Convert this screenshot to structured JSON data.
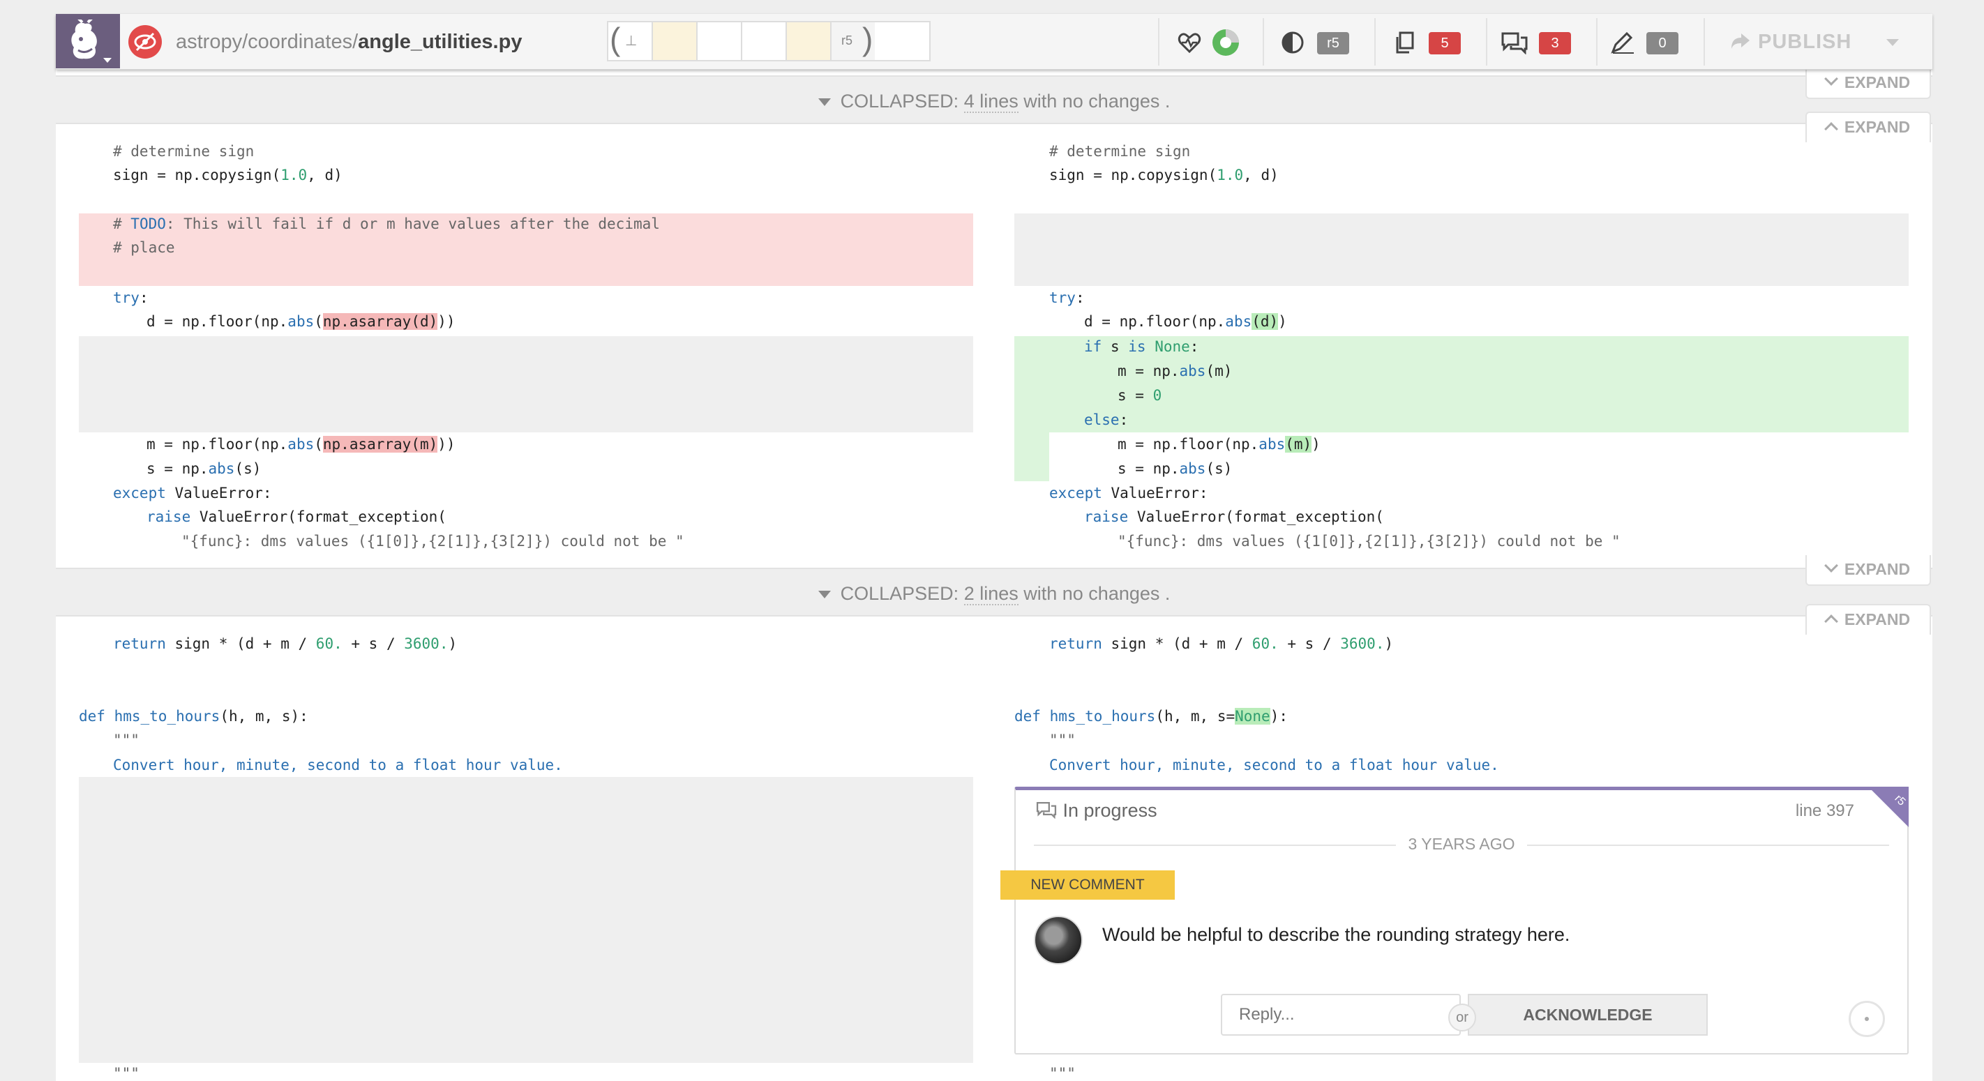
{
  "toolbar": {
    "path_prefix": "astropy/coordinates/",
    "file_name": "angle_utilities.py",
    "rev_base": "⊥",
    "rev_label": "r5",
    "reviewer_badge": "r5",
    "files_count": "5",
    "discussions_count": "3",
    "drafts_count": "0",
    "publish_label": "PUBLISH"
  },
  "collapsed": [
    {
      "label": "COLLAPSED:",
      "count": "4 lines",
      "suffix": " with no changes ."
    },
    {
      "label": "COLLAPSED:",
      "count": "2 lines",
      "suffix": " with no changes ."
    }
  ],
  "expand_label": "EXPAND",
  "code": {
    "comment_determine": "# determine sign",
    "sign_prefix": "sign = np.copysign(",
    "sign_num": "1.0",
    "sign_suffix": ", d)",
    "todo_hash": "# ",
    "todo_kw": "TODO",
    "todo_rest": ": This will fail if d or m have values after the decimal",
    "todo_place": "# place",
    "try": "try",
    "colon": ":",
    "d_line_a": "d = np.floor(np.",
    "abs": "abs",
    "paren": "(",
    "asarray_d": "np.asarray(d)",
    "d_close": "))",
    "d_new_arg": "(d)",
    "m_line_a": "m = np.floor(np.",
    "asarray_m": "np.asarray(m)",
    "s_line_a": "s = np.",
    "s_arg": "(s)",
    "except": "except",
    "except_rest": " ValueError:",
    "raise": "raise",
    "raise_rest": " ValueError(format_exception(",
    "err_str": "\"{func}: dms values ({1[0]},{2[1]},{3[2]}) could not be \"",
    "if": "if",
    "is": "is",
    "none": "None",
    "m_abs_a": "m = np.",
    "m_arg": "(m)",
    "s_zero_a": "s = ",
    "zero": "0",
    "else": "else",
    "m_new_close": "))",
    "return": "return",
    "return_rest_a": " sign * (d + m / ",
    "sixty": "60.",
    "return_rest_b": " + s / ",
    "thirty6": "3600.",
    "return_close": ")",
    "def": "def",
    "func_name": "hms_to_hours",
    "args_old": "(h, m, s):",
    "args_new_a": "(h, m, s=",
    "args_new_b": "):",
    "docquote": "\"\"\"",
    "doc_text": "Convert hour, minute, second to a float hour value."
  },
  "comment": {
    "status": "In progress",
    "line_ref": "line 397",
    "rev": "r5",
    "time": "3 YEARS AGO",
    "tag": "NEW COMMENT",
    "text": "Would be helpful to describe the rounding strategy here.",
    "reply_placeholder": "Reply...",
    "or": "or",
    "ack_label": "ACKNOWLEDGE"
  },
  "colors": {
    "accent": "#8b7cb5",
    "deleted": "#fbdcdc",
    "added": "#dcf5dc",
    "badge_red": "#d64545",
    "tag_yellow": "#f5c842"
  },
  "icons": [
    "reviewable-logo-icon",
    "eye-off-icon",
    "heart-pulse-icon",
    "progress-circle-icon",
    "contrast-icon",
    "files-icon",
    "discussions-icon",
    "pencil-icon",
    "publish-icon",
    "chevron-down-icon"
  ]
}
